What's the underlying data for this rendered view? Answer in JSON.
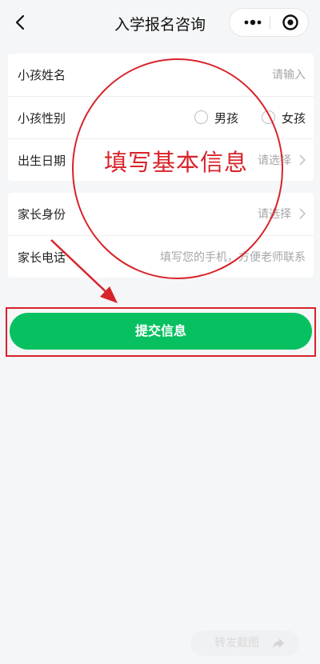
{
  "nav": {
    "title": "入学报名咨询"
  },
  "form": {
    "child_name": {
      "label": "小孩姓名",
      "placeholder": "请输入"
    },
    "gender": {
      "label": "小孩性别",
      "option_boy": "男孩",
      "option_girl": "女孩"
    },
    "birth_date": {
      "label": "出生日期",
      "placeholder": "请选择"
    },
    "parent_identity": {
      "label": "家长身份",
      "placeholder": "请选择"
    },
    "parent_phone": {
      "label": "家长电话",
      "placeholder": "填写您的手机，方便老师联系"
    }
  },
  "submit_label": "提交信息",
  "annotation": {
    "text": "填写基本信息",
    "color": "#d8232a"
  },
  "footer": {
    "forward_label": "转发截图"
  },
  "colors": {
    "accent": "#07c160",
    "background": "#f5f6f8"
  }
}
